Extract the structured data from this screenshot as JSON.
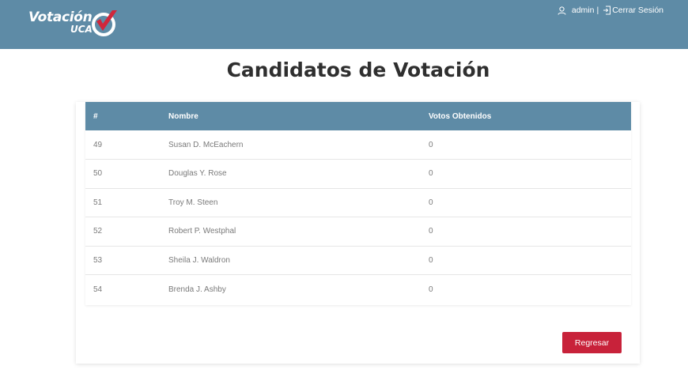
{
  "brand": {
    "line1": "Votación",
    "line2": "UCA",
    "colors": {
      "check": "#d0273c",
      "ring": "#ffffff"
    }
  },
  "user": {
    "icon": "user-icon",
    "name": "admin",
    "separator": "|",
    "logout_icon": "logout-icon",
    "logout_label": "Cerrar Sesión"
  },
  "page": {
    "title": "Candidatos de Votación"
  },
  "table": {
    "headers": [
      "#",
      "Nombre",
      "Votos Obtenidos"
    ],
    "rows": [
      [
        "49",
        "Susan D. McEachern",
        "0"
      ],
      [
        "50",
        "Douglas Y. Rose",
        "0"
      ],
      [
        "51",
        "Troy M. Steen",
        "0"
      ],
      [
        "52",
        "Robert P. Westphal",
        "0"
      ],
      [
        "53",
        "Sheila J. Waldron",
        "0"
      ],
      [
        "54",
        "Brenda J. Ashby",
        "0"
      ]
    ]
  },
  "actions": {
    "back_label": "Regresar"
  },
  "theme": {
    "header": "#5e8ba6",
    "button": "#c8223a"
  }
}
